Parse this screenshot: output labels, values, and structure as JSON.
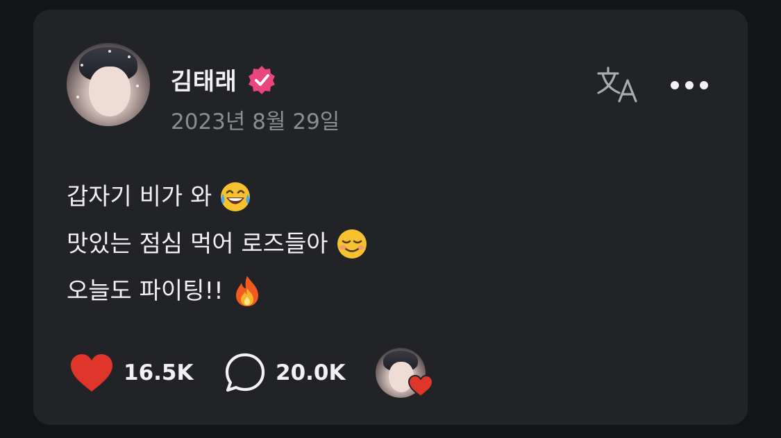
{
  "post": {
    "author_name": "김태래",
    "verified_icon": "verified-badge-icon",
    "date": "2023년 8월 29일",
    "lines": [
      {
        "text": "갑자기 비가 와",
        "emoji": "joy-laughing-tears-emoji"
      },
      {
        "text": "맛있는 점심 먹어 로즈들아",
        "emoji": "smiling-relaxed-emoji"
      },
      {
        "text": "오늘도 파이팅!!",
        "emoji": "fire-emoji"
      }
    ]
  },
  "header_actions": {
    "translate_icon": "translate-icon",
    "more_icon": "more-options-icon"
  },
  "actions": {
    "like_count": "16.5K",
    "comment_count": "20.0K",
    "like_icon": "heart-icon",
    "comment_icon": "comment-bubble-icon"
  },
  "colors": {
    "background": "#141518",
    "card": "#222326",
    "text_primary": "#f2f2f4",
    "text_secondary": "#8b8d93",
    "verified_pink": "#e8467c",
    "heart_red": "#e0352b"
  }
}
